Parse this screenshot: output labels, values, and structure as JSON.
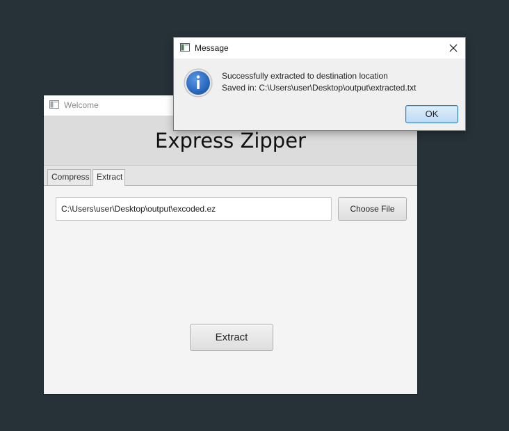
{
  "main_window": {
    "title": "Welcome",
    "app_heading": "Express Zipper",
    "tabs": [
      {
        "label": "Compress",
        "selected": false
      },
      {
        "label": "Extract",
        "selected": true
      }
    ],
    "extract_tab": {
      "file_path_value": "C:\\Users\\user\\Desktop\\output\\excoded.ez",
      "choose_file_label": "Choose File",
      "extract_label": "Extract"
    }
  },
  "dialog": {
    "title": "Message",
    "icon": "info-icon",
    "message_line1": "Successfully extracted to destination location",
    "message_line2": "Saved in: C:\\Users\\user\\Desktop\\output\\extracted.txt",
    "ok_label": "OK"
  },
  "colors": {
    "desktop_background": "#263238",
    "info_icon_blue": "#2b6cc4",
    "ok_button_border": "#2f7fc1"
  }
}
